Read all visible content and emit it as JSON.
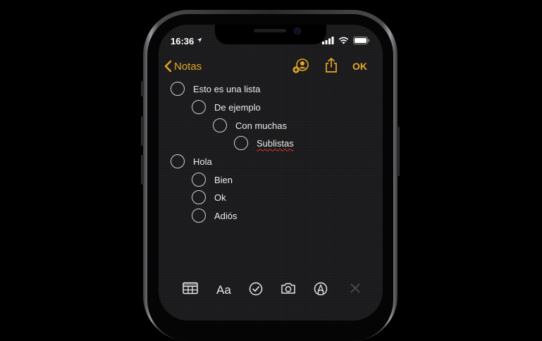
{
  "status_bar": {
    "time": "16:36"
  },
  "nav": {
    "back_label": "Notas",
    "done_label": "OK"
  },
  "checklist": [
    {
      "text": "Esto es una lista",
      "level": 0,
      "checked": false
    },
    {
      "text": "De ejemplo",
      "level": 1,
      "checked": false
    },
    {
      "text": "Con muchas",
      "level": 2,
      "checked": false
    },
    {
      "text": "Sublistas",
      "level": 3,
      "checked": false,
      "spellcheck_flag": true
    },
    {
      "text": "Hola",
      "level": 0,
      "checked": false
    },
    {
      "text": "Bien",
      "level": 1,
      "checked": false
    },
    {
      "text": "Ok",
      "level": 1,
      "checked": false
    },
    {
      "text": "Adiós",
      "level": 1,
      "checked": false
    }
  ],
  "toolbar": {
    "format_label": "Aa"
  },
  "colors": {
    "accent": "#e6a824",
    "background": "#1c1c1e",
    "text": "#ececec"
  },
  "icons": [
    "location-arrow-icon",
    "cellular-signal-icon",
    "wifi-icon",
    "battery-icon",
    "chevron-left-icon",
    "add-person-icon",
    "share-icon",
    "table-icon",
    "checklist-icon",
    "camera-icon",
    "markup-pen-icon",
    "close-icon"
  ]
}
